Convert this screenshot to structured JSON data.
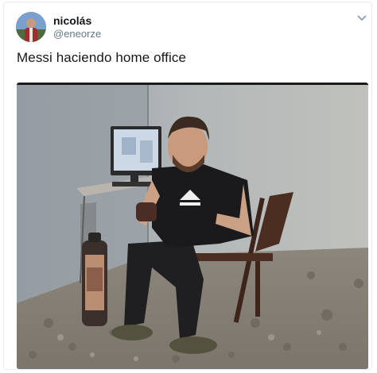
{
  "tweet": {
    "author": {
      "display_name": "nicolás",
      "handle": "@eneorze",
      "avatar_icon": "profile-photo"
    },
    "menu_icon": "chevron-down-icon",
    "text": "Messi haciendo home office",
    "media": {
      "description_icon": "photo"
    }
  },
  "colors": {
    "text_primary": "#14171a",
    "text_secondary": "#657786",
    "border": "#e6ecf0"
  }
}
